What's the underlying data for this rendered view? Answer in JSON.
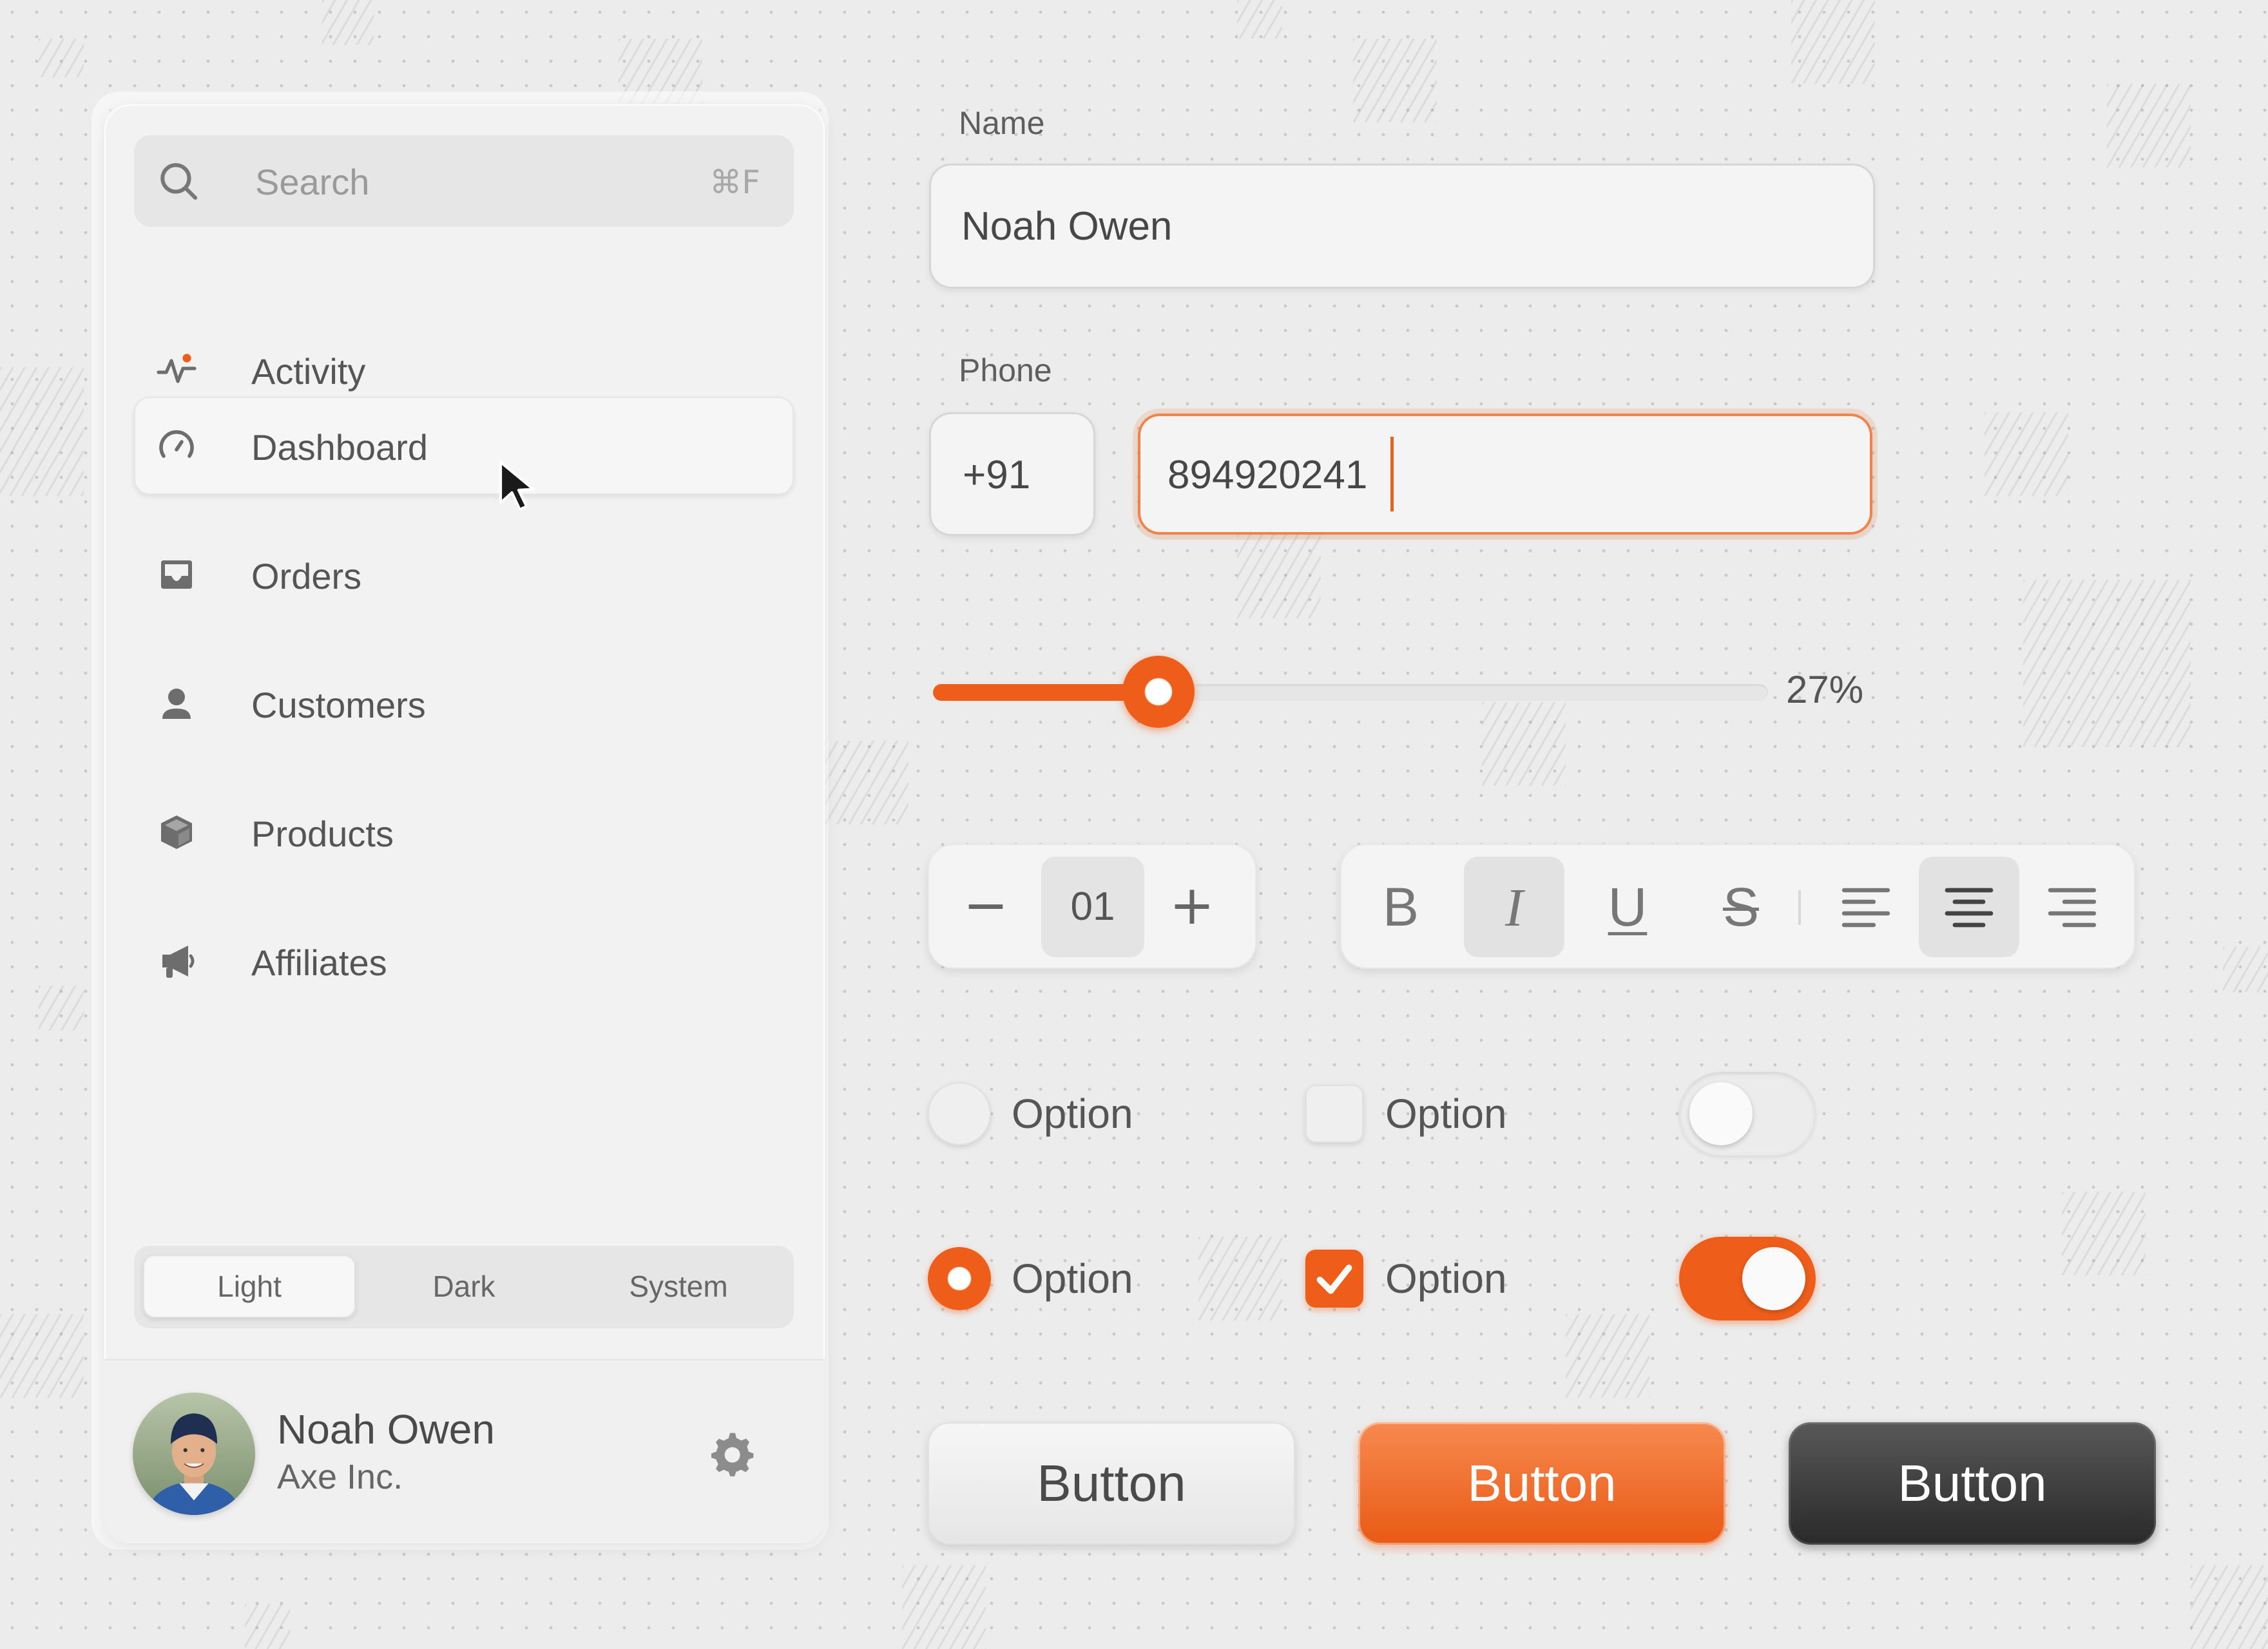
{
  "colors": {
    "accent": "#EE5E1A",
    "dark_button": "#2F2F2F",
    "surface": "#F2F2F2"
  },
  "sidebar": {
    "search": {
      "placeholder": "Search",
      "shortcut": "⌘F",
      "icon": "search-icon"
    },
    "items": [
      {
        "label": "Activity",
        "icon": "activity-icon",
        "active": false
      },
      {
        "label": "Dashboard",
        "icon": "gauge-icon",
        "active": true
      },
      {
        "label": "Orders",
        "icon": "inbox-icon",
        "active": false
      },
      {
        "label": "Customers",
        "icon": "user-icon",
        "active": false
      },
      {
        "label": "Products",
        "icon": "box-icon",
        "active": false
      },
      {
        "label": "Affiliates",
        "icon": "megaphone-icon",
        "active": false
      }
    ],
    "theme": {
      "options": [
        "Light",
        "Dark",
        "System"
      ],
      "selected": "Light"
    },
    "user": {
      "name": "Noah Owen",
      "company": "Axe Inc."
    }
  },
  "form": {
    "name": {
      "label": "Name",
      "value": "Noah Owen"
    },
    "phone": {
      "label": "Phone",
      "country_code": "+91",
      "value": "894920241"
    },
    "slider": {
      "value_percent": 27,
      "display": "27%"
    },
    "stepper": {
      "value": "01",
      "minus": "−",
      "plus": "+"
    },
    "format_toolbar": {
      "bold": "B",
      "italic": "I",
      "underline": "U",
      "strikethrough": "S",
      "active": [
        "italic",
        "align-center"
      ]
    },
    "options": {
      "radio_unchecked": "Option",
      "checkbox_unchecked": "Option",
      "radio_checked": "Option",
      "checkbox_checked": "Option"
    },
    "buttons": {
      "light": "Button",
      "primary": "Button",
      "dark": "Button"
    }
  }
}
